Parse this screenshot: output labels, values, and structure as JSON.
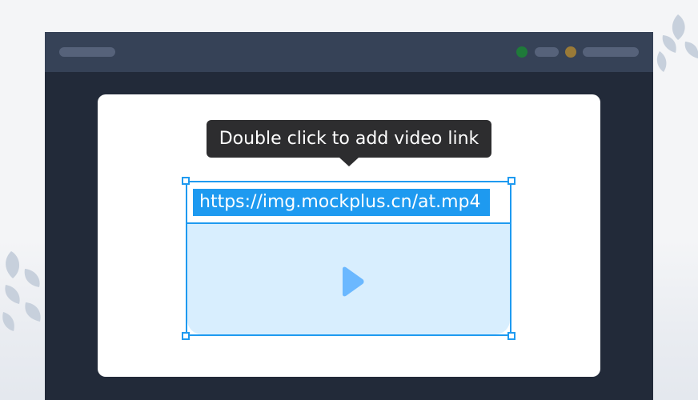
{
  "editor": {
    "tooltip": "Double click to add video link",
    "video": {
      "link_value": "https://img.mockplus.cn/at.mp4",
      "selected": true
    }
  },
  "icons": {
    "play": "play-icon",
    "leaf": "leaf-icon"
  },
  "colors": {
    "page_background": "#f4f5f7",
    "browser_frame": "#222a39",
    "topbar": "#364257",
    "panel": "#ffffff",
    "tooltip_background": "#2d2d2f",
    "selection_accent": "#1e9af0",
    "video_preview_fill": "#d8eefe",
    "play_icon": "#6bb8ff",
    "window_dot_green": "#1f7a3a",
    "window_dot_amber": "#9a7a37"
  }
}
